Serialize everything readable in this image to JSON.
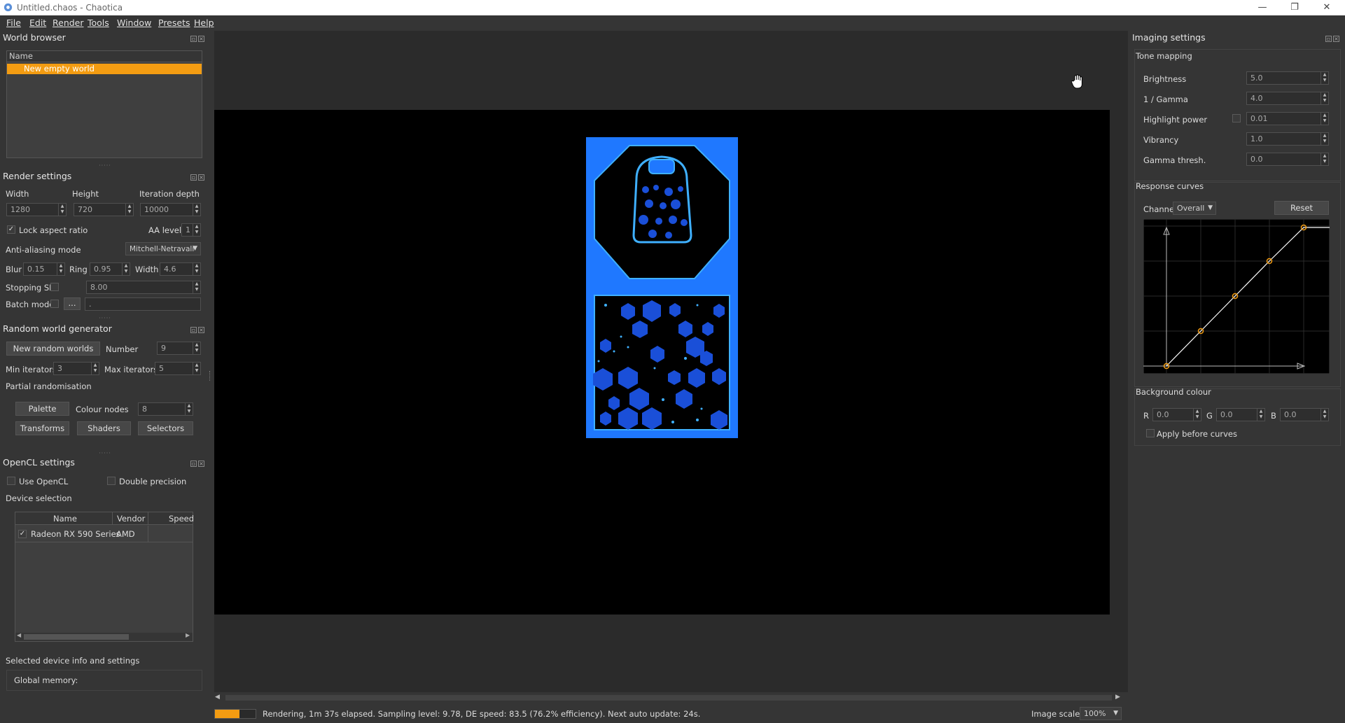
{
  "window": {
    "title": "Untitled.chaos - Chaotica",
    "minimize": "—",
    "maximize": "❐",
    "close": "✕"
  },
  "menu": [
    "File",
    "Edit",
    "Render",
    "Tools",
    "Window",
    "Presets",
    "Help"
  ],
  "world_browser": {
    "title": "World browser",
    "column": "Name",
    "items": [
      "New empty world"
    ]
  },
  "render_settings": {
    "title": "Render settings",
    "width_label": "Width",
    "width": "1280",
    "height_label": "Height",
    "height": "720",
    "depth_label": "Iteration depth",
    "depth": "10000",
    "lock_aspect": "Lock aspect ratio",
    "aa_level_label": "AA level",
    "aa_level": "1",
    "aa_mode_label": "Anti-aliasing mode",
    "aa_mode": "Mitchell-Netravali",
    "blur_label": "Blur",
    "blur": "0.15",
    "ring_label": "Ring",
    "ring": "0.95",
    "width2_label": "Width",
    "width2": "4.6",
    "stopping_label": "Stopping SL",
    "stopping": "8.00",
    "batch_label": "Batch mode",
    "batch_btn": "...",
    "batch_value": "."
  },
  "random_world": {
    "title": "Random world generator",
    "new_btn": "New random worlds",
    "number_label": "Number",
    "number": "9",
    "min_label": "Min iterators",
    "min": "3",
    "max_label": "Max iterators",
    "max": "5",
    "partial_label": "Partial randomisation",
    "palette_btn": "Palette",
    "colour_nodes_label": "Colour nodes",
    "colour_nodes": "8",
    "transforms_btn": "Transforms",
    "shaders_btn": "Shaders",
    "selectors_btn": "Selectors"
  },
  "opencl": {
    "title": "OpenCL settings",
    "use_label": "Use OpenCL",
    "double_label": "Double precision",
    "device_sel_label": "Device selection",
    "columns": [
      "Name",
      "Vendor",
      "Speed"
    ],
    "devices": [
      {
        "name": "Radeon RX 590 Series",
        "vendor": "AMD",
        "speed": ""
      }
    ],
    "selected_info_label": "Selected device info and settings",
    "global_memory_label": "Global memory:"
  },
  "imaging": {
    "title": "Imaging settings",
    "tone_label": "Tone mapping",
    "brightness_label": "Brightness",
    "brightness": "5.0",
    "gamma_label": "1 / Gamma",
    "gamma": "4.0",
    "highlight_label": "Highlight power",
    "highlight": "0.01",
    "vibrancy_label": "Vibrancy",
    "vibrancy": "1.0",
    "gamma_thresh_label": "Gamma thresh.",
    "gamma_thresh": "0.0",
    "curves_label": "Response curves",
    "channel_label": "Channel:",
    "channel": "Overall",
    "reset_btn": "Reset",
    "bg_label": "Background colour",
    "r_label": "R",
    "r": "0.0",
    "g_label": "G",
    "g": "0.0",
    "b_label": "B",
    "b": "0.0",
    "apply_before_label": "Apply before curves"
  },
  "status": {
    "progress": 0.6,
    "text": "Rendering, 1m 37s elapsed. Sampling level: 9.78, DE speed: 83.5 (76.2% efficiency). Next auto update: 24s.",
    "scale_label": "Image scale:",
    "scale": "100%"
  },
  "colors": {
    "accent": "#f39c12",
    "preview_blue": "#1f78ff",
    "hex_blue": "#1a4fd8"
  }
}
